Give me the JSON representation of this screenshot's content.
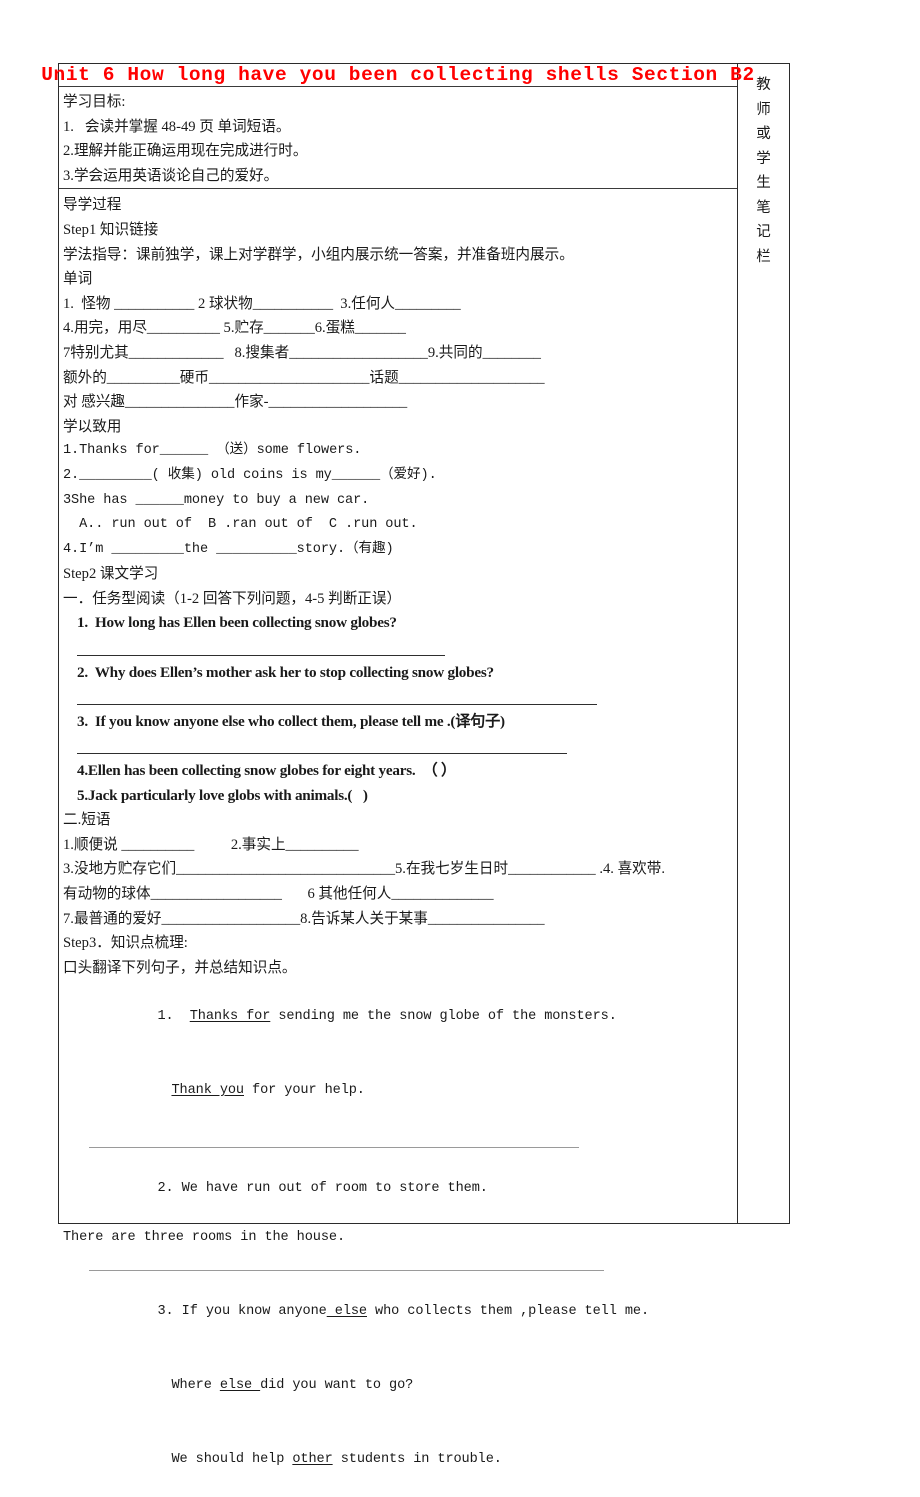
{
  "document": {
    "title": "Unit 6 How long have you been collecting shells Section B2",
    "title_color": "#ff0000"
  },
  "notes_column": {
    "name": "教师或学生笔记栏",
    "chars": [
      "教",
      "师",
      "或",
      "学",
      "生",
      "笔",
      "记",
      "栏"
    ]
  },
  "objectives": {
    "heading": "学习目标:",
    "items": [
      "1.   会读并掌握 48-49 页 单词短语。",
      "2.理解并能正确运用现在完成进行时。",
      "3.学会运用英语谈论自己的爱好。"
    ]
  },
  "body": {
    "process_heading": "导学过程",
    "step1_heading": "Step1 知识链接",
    "study_guide": "学法指导：课前独学，课上对学群学，小组内展示统一答案，并准备班内展示。",
    "vocab_heading": "单词",
    "vocab_lines": [
      "1.  怪物 ___________ 2 球状物___________  3.任何人_________",
      "4.用完，用尽__________ 5.贮存_______6.蛋糕_______",
      "7特别尤其_____________   8.搜集者___________________9.共同的________",
      "额外的__________硬币______________________话题____________________",
      "对 感兴趣_______________作家-___________________"
    ],
    "apply_heading": "学以致用",
    "apply_lines": [
      "1.Thanks for______ （送）some flowers.",
      "2._________( 收集) old coins is my______（爱好).",
      "3She has ______money to buy a new car.",
      "  A.. run out of  B .ran out of  C .run out.",
      "4.I’m _________the __________story.（有趣)"
    ],
    "step2_heading": "Step2 课文学习",
    "reading_heading": "一．任务型阅读（1-2 回答下列问题，4-5 判断正误）",
    "questions": [
      "1.  How long has Ellen been collecting snow globes?",
      "2.  Why does Ellen’s mother ask her to stop collecting snow globes?",
      "3.  If you know anyone else who collect them, please tell me .(译句子)",
      "4.Ellen has been collecting snow globes for eight years.  （ ）",
      "5.Jack particularly love globs with animals.(   )"
    ],
    "phrases_heading": "二.短语",
    "phrase_lines": [
      "1.顺便说 __________          2.事实上__________",
      "3.没地方贮存它们______________________________5.在我七岁生日时____________ .4. 喜欢带.",
      "有动物的球体__________________       6 其他任何人______________",
      "7.最普通的爱好___________________8.告诉某人关于某事________________"
    ],
    "step3_heading": "Step3．知识点梳理:",
    "step3_sub": "口头翻译下列句子，并总结知识点。",
    "sentences": [
      {
        "num": "1.",
        "parts": [
          {
            "text": "Thanks for",
            "underline": true
          },
          {
            "text": " sending me the snow globe of the monsters.",
            "underline": false
          }
        ],
        "extra": [
          [
            {
              "text": "Thank you",
              "underline": true
            },
            {
              "text": " for your help.",
              "underline": false
            }
          ]
        ]
      },
      {
        "num": "2.",
        "parts": [
          {
            "text": " We have run out of room to store them.",
            "underline": false
          }
        ],
        "extra": [
          [
            {
              "text": "There are three rooms in the house.",
              "underline": false
            }
          ]
        ]
      },
      {
        "num": "3.",
        "parts": [
          {
            "text": " If you know anyone",
            "underline": false
          },
          {
            "text": " else",
            "underline": true
          },
          {
            "text": " who collects them ,please tell me.",
            "underline": false
          }
        ],
        "extra": [
          [
            {
              "text": "Where ",
              "underline": false
            },
            {
              "text": "else ",
              "underline": true
            },
            {
              "text": "did you want to go?",
              "underline": false
            }
          ],
          [
            {
              "text": "We should help ",
              "underline": false
            },
            {
              "text": "other",
              "underline": true
            },
            {
              "text": " students in trouble.",
              "underline": false
            }
          ]
        ]
      }
    ]
  }
}
